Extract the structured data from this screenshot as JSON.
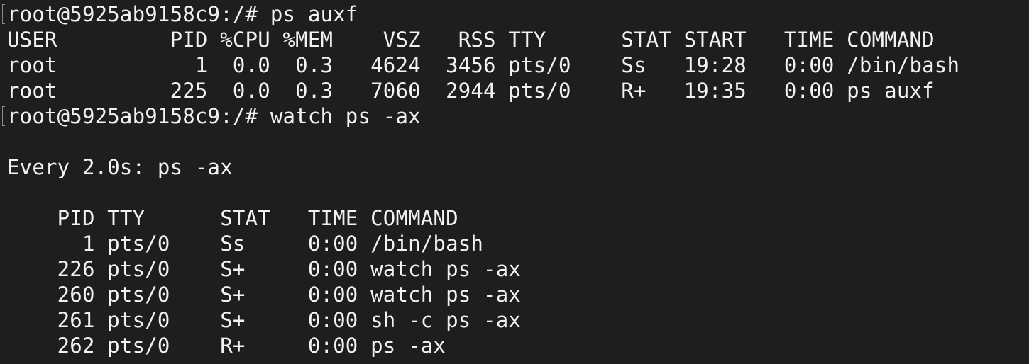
{
  "terminal": {
    "lines": [
      "root@5925ab9158c9:/# ps auxf",
      "USER         PID %CPU %MEM    VSZ   RSS TTY      STAT START   TIME COMMAND",
      "root           1  0.0  0.3   4624  3456 pts/0    Ss   19:28   0:00 /bin/bash",
      "root         225  0.0  0.3   7060  2944 pts/0    R+   19:35   0:00 ps auxf",
      "root@5925ab9158c9:/# watch ps -ax",
      "Every 2.0s: ps -ax",
      "    PID TTY      STAT   TIME COMMAND",
      "      1 pts/0    Ss     0:00 /bin/bash",
      "    226 pts/0    S+     0:00 watch ps -ax",
      "    260 pts/0    S+     0:00 watch ps -ax",
      "    261 pts/0    S+     0:00 sh -c ps -ax",
      "    262 pts/0    R+     0:00 ps -ax"
    ]
  },
  "colors": {
    "background": "#1e1e1e",
    "foreground": "#f2f2f2",
    "prompt_mark": "#8a8a8a"
  }
}
